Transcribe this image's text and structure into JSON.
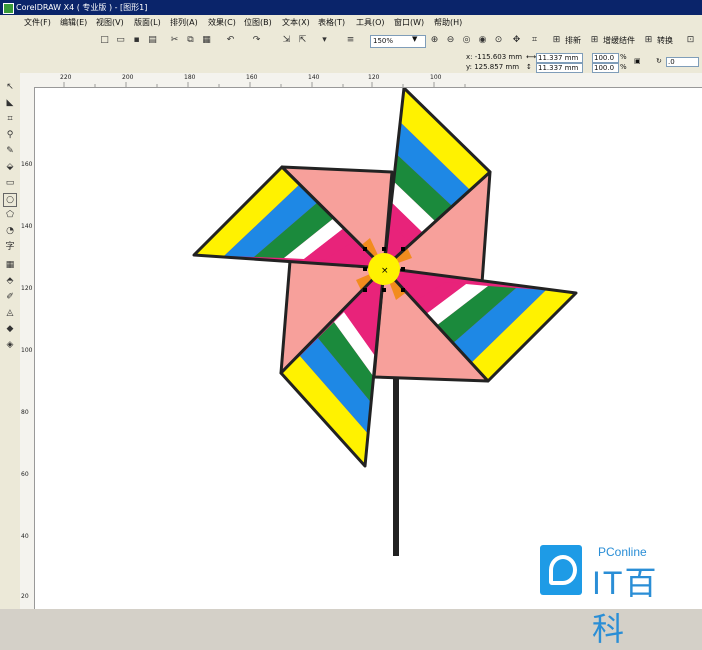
{
  "window": {
    "title": "CorelDRAW X4 ( 专业版 ) - [图形1]"
  },
  "menu": [
    {
      "label": "文件(F)"
    },
    {
      "label": "编辑(E)"
    },
    {
      "label": "视图(V)"
    },
    {
      "label": "版面(L)"
    },
    {
      "label": "排列(A)"
    },
    {
      "label": "效果(C)"
    },
    {
      "label": "位图(B)"
    },
    {
      "label": "文本(X)"
    },
    {
      "label": "表格(T)"
    },
    {
      "label": "工具(O)"
    },
    {
      "label": "窗口(W)"
    },
    {
      "label": "帮助(H)"
    }
  ],
  "toolbar": {
    "zoom": "150%",
    "arrange_label": "排新",
    "enhance_label": "增缓结件",
    "convert_label": "转换"
  },
  "properties": {
    "x": "x: -115.603 mm",
    "y": "y: 125.857 mm",
    "width": "11.337 mm",
    "height": "11.337 mm",
    "scale_x": "100.0",
    "scale_y": "100.0",
    "percent": "%",
    "rotation": ".0"
  },
  "ruler": {
    "h_labels": [
      "220",
      "200",
      "180",
      "160",
      "140",
      "120",
      "100"
    ],
    "v_labels": [
      "160",
      "140",
      "120",
      "100",
      "80",
      "60",
      "40",
      "20"
    ]
  },
  "watermark": {
    "small": "PConline",
    "big": "IT百科"
  },
  "colors": {
    "yellow": "#FFF200",
    "blue": "#1E88E5",
    "green": "#1B8A3C",
    "magenta": "#E8237A",
    "pink": "#F7A09B",
    "orange": "#F28C1E",
    "outline": "#222222"
  }
}
